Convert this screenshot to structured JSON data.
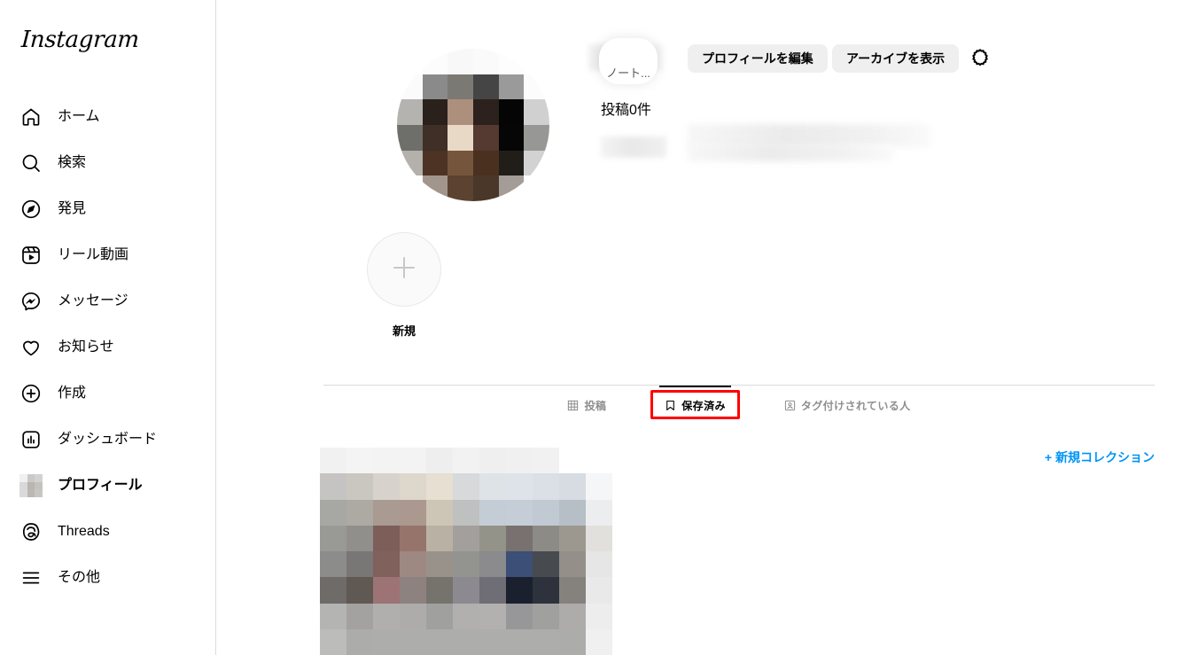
{
  "brand": {
    "name": "Instagram"
  },
  "sidebar": {
    "items": [
      {
        "label": "ホーム",
        "icon": "home-icon",
        "active": false
      },
      {
        "label": "検索",
        "icon": "search-icon",
        "active": false
      },
      {
        "label": "発見",
        "icon": "explore-icon",
        "active": false
      },
      {
        "label": "リール動画",
        "icon": "reels-icon",
        "active": false
      },
      {
        "label": "メッセージ",
        "icon": "messenger-icon",
        "active": false
      },
      {
        "label": "お知らせ",
        "icon": "heart-icon",
        "active": false
      },
      {
        "label": "作成",
        "icon": "plus-circle-icon",
        "active": false
      },
      {
        "label": "ダッシュボード",
        "icon": "dashboard-icon",
        "active": false
      },
      {
        "label": "プロフィール",
        "icon": "profile-avatar-icon",
        "active": true
      },
      {
        "label": "Threads",
        "icon": "threads-icon",
        "active": false
      },
      {
        "label": "その他",
        "icon": "hamburger-icon",
        "active": false
      }
    ]
  },
  "profile": {
    "note_bubble_text": "ノート...",
    "username_masked": "",
    "posts_count_label": "投稿0件",
    "edit_profile_label": "プロフィールを編集",
    "view_archive_label": "アーカイブを表示",
    "settings_icon": "gear-icon"
  },
  "highlights": {
    "new_label": "新規",
    "new_icon": "plus-icon"
  },
  "tabs": [
    {
      "label": "投稿",
      "icon": "grid-icon",
      "active": false,
      "highlighted": false
    },
    {
      "label": "保存済み",
      "icon": "bookmark-icon",
      "active": true,
      "highlighted": true
    },
    {
      "label": "タグ付けされている人",
      "icon": "tagged-icon",
      "active": false,
      "highlighted": false
    }
  ],
  "collections": {
    "new_collection_label": "+ 新規コレクション"
  },
  "colors": {
    "accent_blue": "#0095f6",
    "highlight_red": "#ff0000",
    "button_gray": "#efefef",
    "muted_text": "#8e8e8e",
    "border": "#dbdbdb"
  },
  "mosaics": {
    "sidebar_avatar": [
      "#f0f0f0",
      "#c9c9c9",
      "#d2d2d2",
      "#d8d8d8",
      "#b9b6b1",
      "#c4c2bd",
      "#dadada",
      "#bbb8b3",
      "#c8c6c1"
    ],
    "profile_avatar": [
      "#ffffff",
      "#fcfcfc",
      "#f8f8f8",
      "#fafafa",
      "#fdfdfd",
      "#ffffff",
      "#fbfbfb",
      "#8a8a8a",
      "#7b7974",
      "#454545",
      "#9a9a9a",
      "#fcfcfc",
      "#b4b3b0",
      "#2b211c",
      "#ad8f7e",
      "#2c211c",
      "#050505",
      "#d0d0d0",
      "#6e6e6b",
      "#3f2f26",
      "#e8d8c6",
      "#543a30",
      "#060606",
      "#979795",
      "#b4b0ab",
      "#4c3324",
      "#75563d",
      "#49301f",
      "#211e19",
      "#d2d2d2",
      "#fdfdfd",
      "#a2958c",
      "#5c4230",
      "#4a3729",
      "#a39c97",
      "#fdfdfd"
    ],
    "collection_thumb": [
      "#f1f1f1",
      "#f4f4f4",
      "#f3f3f3",
      "#f3f3f3",
      "#eeeeee",
      "#f2f2f2",
      "#efefef",
      "#f0f0f0",
      "#f1f1f1",
      "#ffffff",
      "#ffffff",
      "#c5c4c2",
      "#cac7c1",
      "#d7d3cc",
      "#ded7cb",
      "#e6dfd2",
      "#d7d9da",
      "#dee3e8",
      "#dde3e9",
      "#dae0e6",
      "#d6dce2",
      "#f5f6f7",
      "#a7a7a3",
      "#adaaa4",
      "#a99a92",
      "#ab988e",
      "#cdc5b5",
      "#bfc0c0",
      "#c4cdd5",
      "#c5ced6",
      "#c1cad3",
      "#b6bec6",
      "#ecedee",
      "#999996",
      "#918f8c",
      "#7e5e59",
      "#96746c",
      "#b9b2a4",
      "#a29f9c",
      "#939389",
      "#78716f",
      "#8c8b85",
      "#9d988f",
      "#e2e0dc",
      "#8c8c8a",
      "#787775",
      "#80615c",
      "#9e8982",
      "#99928a",
      "#93938f",
      "#8b8a8d",
      "#3b4f77",
      "#474a4f",
      "#949089",
      "#e6e6e6",
      "#6e6b69",
      "#5f5853",
      "#9d7376",
      "#8d8280",
      "#75736c",
      "#8c8a90",
      "#6f6d75",
      "#1b202e",
      "#2d323c",
      "#85827d",
      "#e9e9e9",
      "#b4b4b2",
      "#a3a2a0",
      "#b0afad",
      "#adacaa",
      "#a0a09e",
      "#b1b0ae",
      "#b2b1af",
      "#97979a",
      "#a0a09f",
      "#adacaa",
      "#ededed",
      "#bcbcba",
      "#acacaa",
      "#adadab",
      "#adadab",
      "#adadab",
      "#adadab",
      "#adadab",
      "#adadab",
      "#adadab",
      "#acacaa",
      "#f0f0f0"
    ]
  }
}
